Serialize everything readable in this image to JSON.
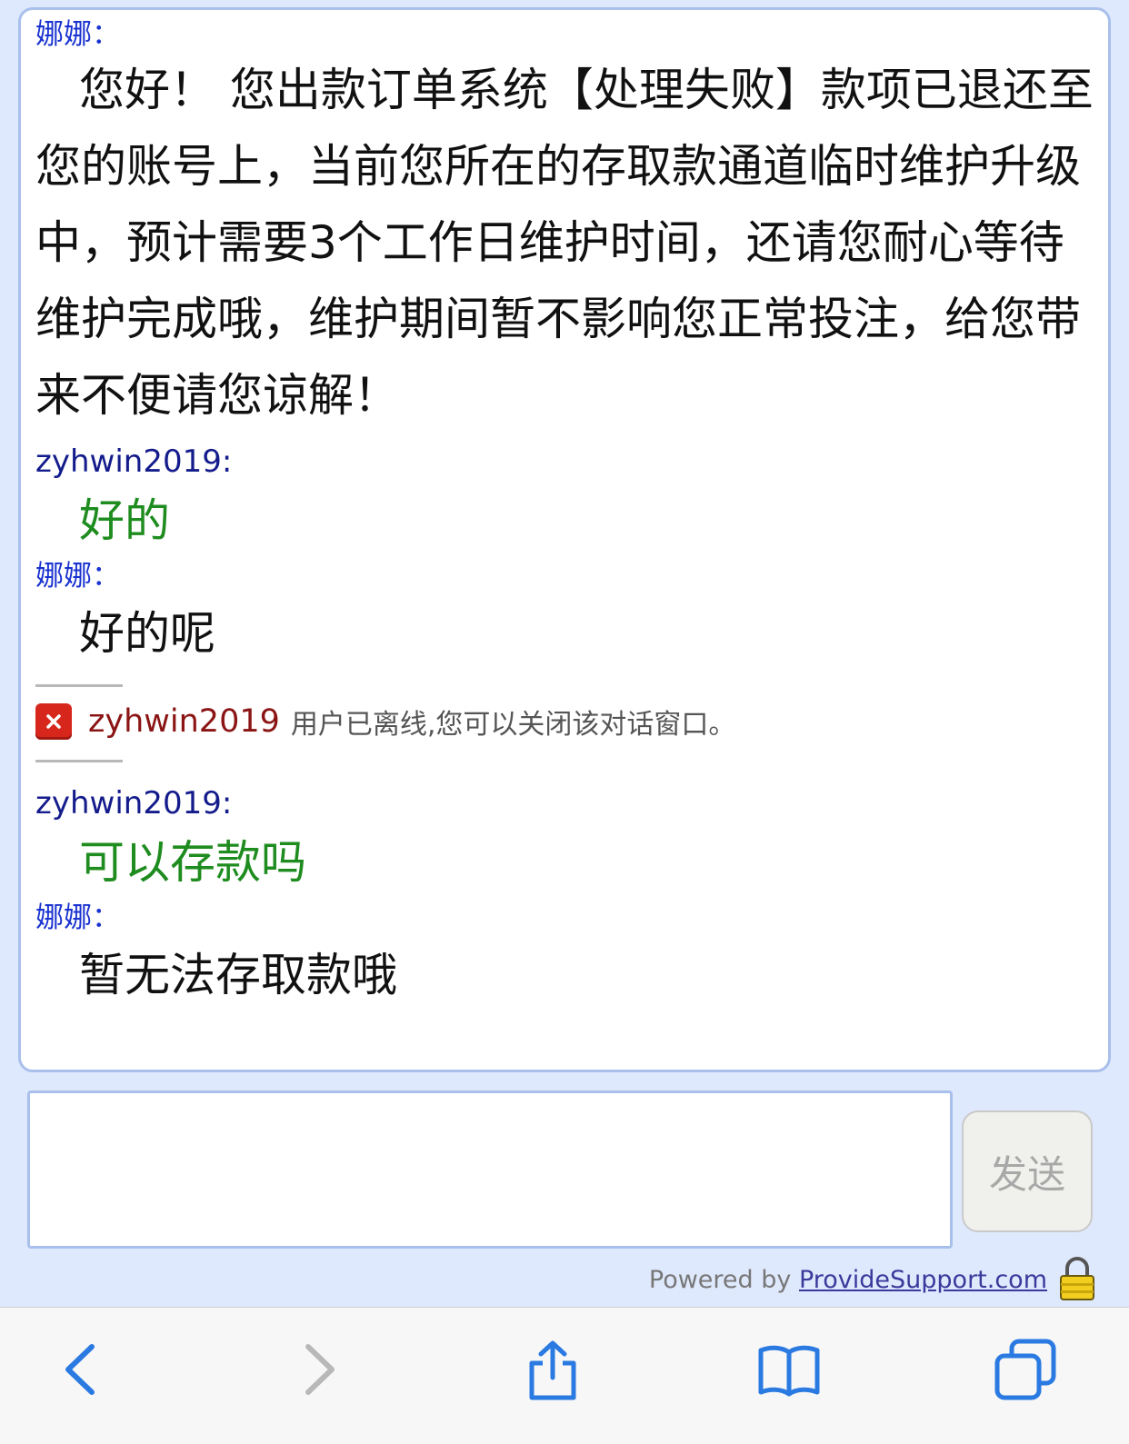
{
  "messages": [
    {
      "sender": "娜娜：",
      "role": "agent",
      "text": "您好！ 您出款订单系统【处理失败】款项已退还至您的账号上，当前您所在的存取款通道临时维护升级中，预计需要3个工作日维护时间，还请您耐心等待维护完成哦，维护期间暂不影响您正常投注，给您带来不便请您谅解！"
    },
    {
      "sender": "zyhwin2019:",
      "role": "user",
      "text": "好的"
    },
    {
      "sender": "娜娜：",
      "role": "agent",
      "text": "好的呢"
    }
  ],
  "notice": {
    "username": "zyhwin2019",
    "text": "用户已离线,您可以关闭该对话窗口。"
  },
  "messages2": [
    {
      "sender": "zyhwin2019:",
      "role": "user",
      "text": "可以存款吗"
    },
    {
      "sender": "娜娜：",
      "role": "agent",
      "text": "暂无法存取款哦"
    }
  ],
  "input": {
    "placeholder": ""
  },
  "send_label": "发送",
  "powered": {
    "prefix": "Powered by ",
    "link": "ProvideSupport.com"
  },
  "icons": {
    "offline": "close-icon",
    "lock": "lock-icon"
  },
  "colors": {
    "agent_name": "#1a33d0",
    "user_name": "#141c8c",
    "user_text": "#1e8c1e",
    "accent_blue": "#2a7ae2"
  }
}
